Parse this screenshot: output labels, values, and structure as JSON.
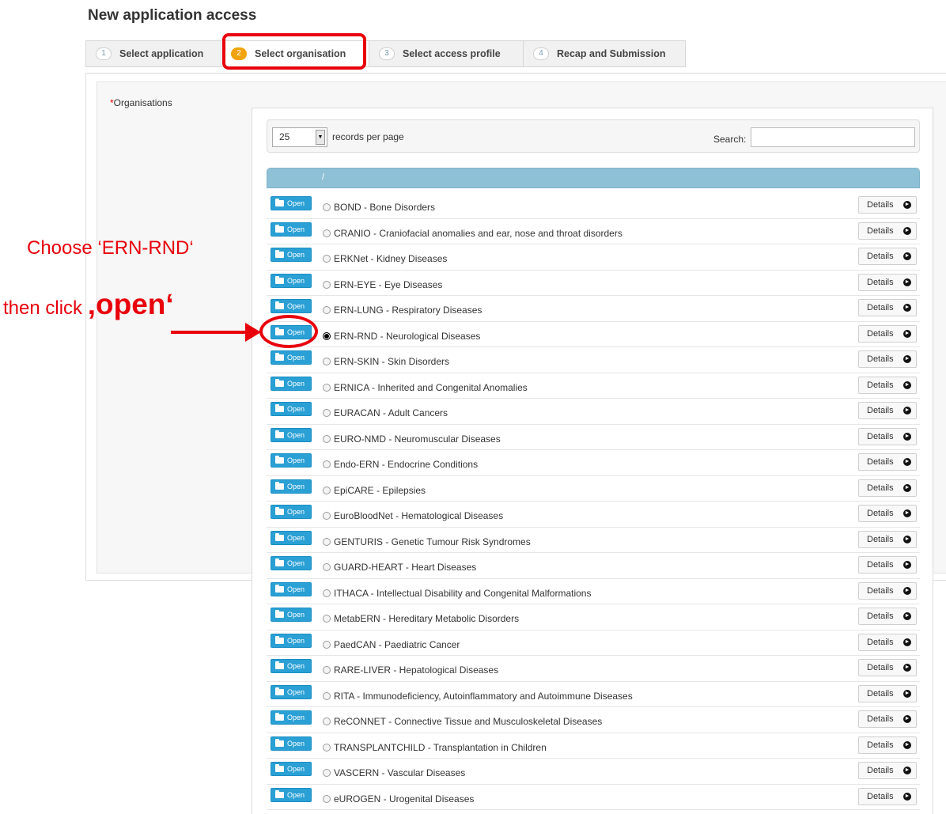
{
  "page": {
    "title": "New application access"
  },
  "wizard": {
    "steps": [
      {
        "num": "1",
        "label": "Select application"
      },
      {
        "num": "2",
        "label": "Select organisation"
      },
      {
        "num": "3",
        "label": "Select access profile"
      },
      {
        "num": "4",
        "label": "Recap and Submission"
      }
    ],
    "active_step": 2
  },
  "form": {
    "required_mark": "*",
    "organisations_label": "Organisations"
  },
  "table_controls": {
    "page_size": "25",
    "records_per_page_label": "records per page",
    "search_label": "Search:",
    "search_value": ""
  },
  "table": {
    "header_separator": "/"
  },
  "buttons": {
    "open_label": "Open",
    "details_label": "Details"
  },
  "organisations": [
    {
      "name": "BOND - Bone Disorders",
      "selected": false
    },
    {
      "name": "CRANIO - Craniofacial anomalies and ear, nose and throat disorders",
      "selected": false
    },
    {
      "name": "ERKNet - Kidney Diseases",
      "selected": false
    },
    {
      "name": "ERN-EYE - Eye Diseases",
      "selected": false
    },
    {
      "name": "ERN-LUNG - Respiratory Diseases",
      "selected": false
    },
    {
      "name": "ERN-RND - Neurological Diseases",
      "selected": true
    },
    {
      "name": "ERN-SKIN - Skin Disorders",
      "selected": false
    },
    {
      "name": "ERNICA - Inherited and Congenital Anomalies",
      "selected": false
    },
    {
      "name": "EURACAN - Adult Cancers",
      "selected": false
    },
    {
      "name": "EURO-NMD - Neuromuscular Diseases",
      "selected": false
    },
    {
      "name": "Endo-ERN - Endocrine Conditions",
      "selected": false
    },
    {
      "name": "EpiCARE - Epilepsies",
      "selected": false
    },
    {
      "name": "EuroBloodNet - Hematological Diseases",
      "selected": false
    },
    {
      "name": "GENTURIS - Genetic Tumour Risk Syndromes",
      "selected": false
    },
    {
      "name": "GUARD-HEART - Heart Diseases",
      "selected": false
    },
    {
      "name": "ITHACA - Intellectual Disability and Congenital Malformations",
      "selected": false
    },
    {
      "name": "MetabERN - Hereditary Metabolic Disorders",
      "selected": false
    },
    {
      "name": "PaedCAN - Paediatric Cancer",
      "selected": false
    },
    {
      "name": "RARE-LIVER - Hepatological Diseases",
      "selected": false
    },
    {
      "name": "RITA - Immunodeficiency, Autoinflammatory and Autoimmune Diseases",
      "selected": false
    },
    {
      "name": "ReCONNET - Connective Tissue and Musculoskeletal Diseases",
      "selected": false
    },
    {
      "name": "TRANSPLANTCHILD - Transplantation in Children",
      "selected": false
    },
    {
      "name": "VASCERN - Vascular Diseases",
      "selected": false
    },
    {
      "name": "eUROGEN - Urogenital Diseases",
      "selected": false
    }
  ],
  "annotations": {
    "line1": "Choose ‘ERN-RND‘",
    "line2_prefix": "then click ",
    "line2_emphasis": "‚open‘",
    "color": "#e8000b"
  },
  "colors": {
    "accent": "#2aa0d5",
    "active_step": "#f0a30a",
    "table_header": "#8fc1d6"
  }
}
